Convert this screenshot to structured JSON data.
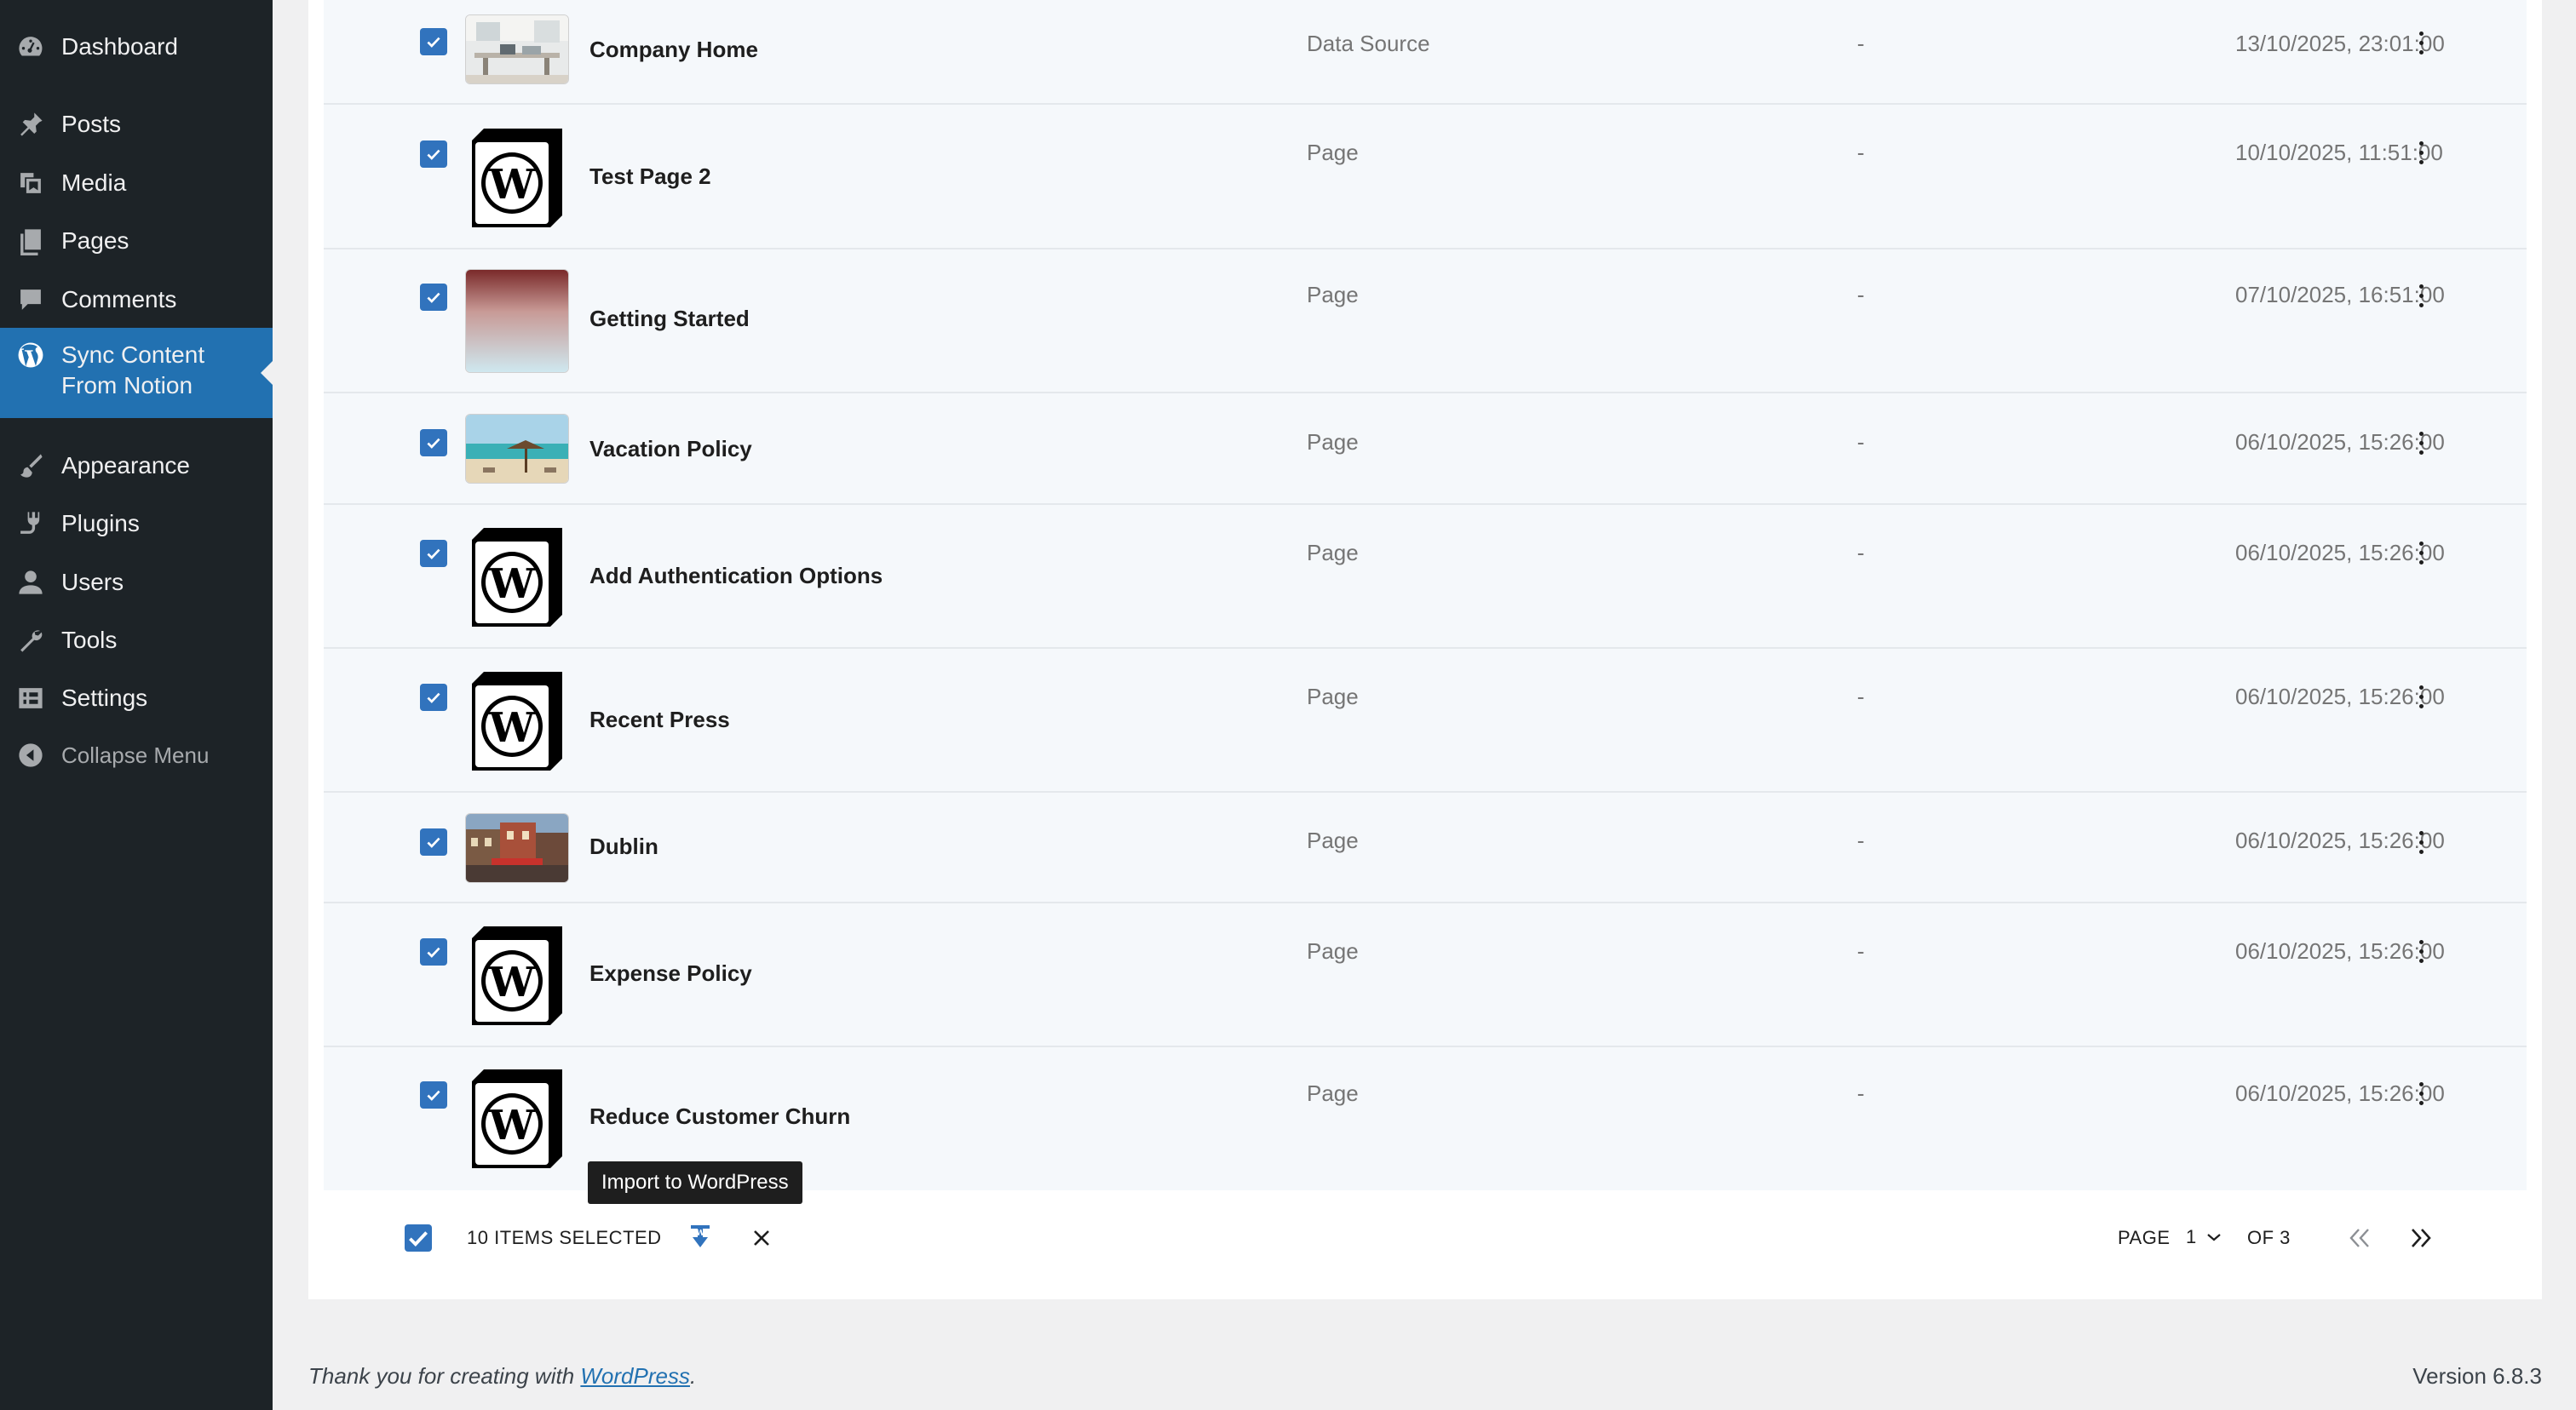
{
  "sidebar": {
    "items": [
      {
        "label": "Dashboard",
        "icon": "dashboard-icon"
      },
      {
        "label": "Posts",
        "icon": "pushpin-icon"
      },
      {
        "label": "Media",
        "icon": "media-icon"
      },
      {
        "label": "Pages",
        "icon": "pages-icon"
      },
      {
        "label": "Comments",
        "icon": "comment-icon"
      },
      {
        "label": "Sync Content From Notion",
        "icon": "wordpress-logo-icon",
        "active": true
      },
      {
        "label": "Appearance",
        "icon": "paintbrush-icon"
      },
      {
        "label": "Plugins",
        "icon": "plugin-icon"
      },
      {
        "label": "Users",
        "icon": "user-icon"
      },
      {
        "label": "Tools",
        "icon": "wrench-icon"
      },
      {
        "label": "Settings",
        "icon": "settings-icon"
      },
      {
        "label": "Collapse Menu",
        "icon": "collapse-icon"
      }
    ]
  },
  "rows": [
    {
      "title": "Company Home",
      "type": "Data Source",
      "author": "-",
      "date": "13/10/2025, 23:01:00",
      "checked": true,
      "thumbnail": "photo-office"
    },
    {
      "title": "Test Page 2",
      "type": "Page",
      "author": "-",
      "date": "10/10/2025, 11:51:00",
      "checked": true,
      "thumbnail": "notion-wp-cube"
    },
    {
      "title": "Getting Started",
      "type": "Page",
      "author": "-",
      "date": "07/10/2025, 16:51:00",
      "checked": true,
      "thumbnail": "gradient"
    },
    {
      "title": "Vacation Policy",
      "type": "Page",
      "author": "-",
      "date": "06/10/2025, 15:26:00",
      "checked": true,
      "thumbnail": "photo-beach"
    },
    {
      "title": "Add Authentication Options",
      "type": "Page",
      "author": "-",
      "date": "06/10/2025, 15:26:00",
      "checked": true,
      "thumbnail": "notion-wp-cube"
    },
    {
      "title": "Recent Press",
      "type": "Page",
      "author": "-",
      "date": "06/10/2025, 15:26:00",
      "checked": true,
      "thumbnail": "notion-wp-cube"
    },
    {
      "title": "Dublin",
      "type": "Page",
      "author": "-",
      "date": "06/10/2025, 15:26:00",
      "checked": true,
      "thumbnail": "photo-street"
    },
    {
      "title": "Expense Policy",
      "type": "Page",
      "author": "-",
      "date": "06/10/2025, 15:26:00",
      "checked": true,
      "thumbnail": "notion-wp-cube"
    },
    {
      "title": "Reduce Customer Churn",
      "type": "Page",
      "author": "-",
      "date": "06/10/2025, 15:26:00",
      "checked": true,
      "thumbnail": "notion-wp-cube"
    }
  ],
  "tooltip": "Import to WordPress",
  "bulk": {
    "selected_label": "10 ITEMS SELECTED",
    "page_label": "PAGE",
    "page_value": "1",
    "of_label": "OF 3"
  },
  "footer": {
    "thanks_prefix": "Thank you for creating with ",
    "thanks_link": "WordPress",
    "thanks_suffix": ".",
    "version": "Version 6.8.3"
  },
  "colors": {
    "sidebar_bg": "#1d2327",
    "accent": "#2271b1",
    "checkbox": "#3173bd",
    "row_bg": "#f5f8fb"
  }
}
